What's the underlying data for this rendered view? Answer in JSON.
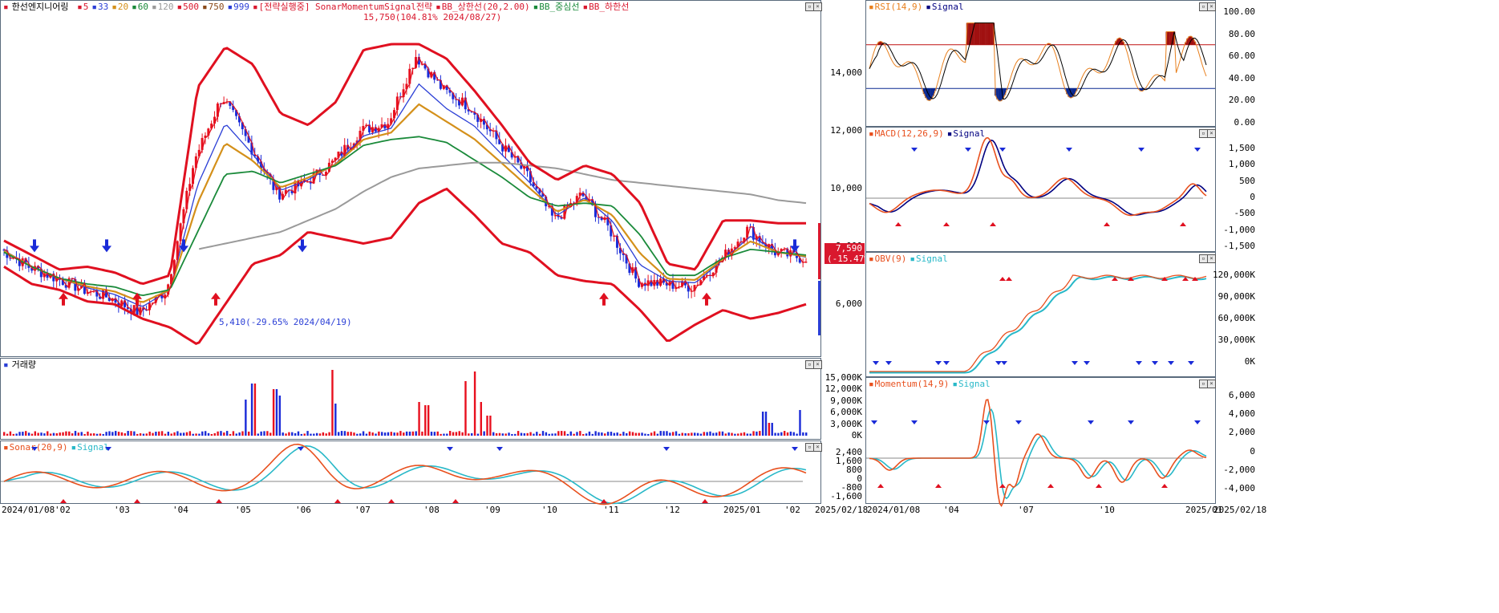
{
  "main_legend": {
    "title": "한선엔지니어링",
    "items": [
      {
        "text": "5",
        "color": "#d9182e"
      },
      {
        "text": "33",
        "color": "#2b3fd6"
      },
      {
        "text": "20",
        "color": "#d4901a"
      },
      {
        "text": "60",
        "color": "#1a8a3a"
      },
      {
        "text": "120",
        "color": "#9a9a9a"
      },
      {
        "text": "500",
        "color": "#d9182e"
      },
      {
        "text": "750",
        "color": "#8a4a1a"
      },
      {
        "text": "999",
        "color": "#2b3fd6"
      },
      {
        "text": "[전략실행중] SonarMomentumSignal전략",
        "color": "#d9182e"
      },
      {
        "text": "BB_상한선(20,2.00)",
        "color": "#d9182e"
      },
      {
        "text": "BB_중심선",
        "color": "#1a8a3a"
      },
      {
        "text": "BB_하한선",
        "color": "#d9182e"
      }
    ]
  },
  "volume_legend": {
    "title": "거래량"
  },
  "sonar_legend": {
    "items": [
      {
        "text": "Sonar(20,9)",
        "color": "#e8501e"
      },
      {
        "text": "Signal",
        "color": "#28b8c8"
      }
    ]
  },
  "rsi_legend": {
    "items": [
      {
        "text": "RSI(14,9)",
        "color": "#e8801e"
      },
      {
        "text": "Signal",
        "color": "#000080"
      }
    ]
  },
  "macd_legend": {
    "items": [
      {
        "text": "MACD(12,26,9)",
        "color": "#e8501e"
      },
      {
        "text": "Signal",
        "color": "#000080"
      }
    ]
  },
  "obv_legend": {
    "items": [
      {
        "text": "OBV(9)",
        "color": "#e8501e"
      },
      {
        "text": "Signal",
        "color": "#28b8c8"
      }
    ]
  },
  "mom_legend": {
    "items": [
      {
        "text": "Momentum(14,9)",
        "color": "#e8501e"
      },
      {
        "text": "Signal",
        "color": "#28b8c8"
      }
    ]
  },
  "annotations": {
    "high": "15,750(104.81% 2024/08/27)",
    "low": "5,410(-29.65% 2024/04/19)",
    "last_price": "7,590",
    "last_change": "(-15.47%)"
  },
  "chart_data": [
    {
      "type": "line",
      "name": "price",
      "x": [
        "2024/01/08",
        "'02",
        "'03",
        "'04",
        "'05",
        "'06",
        "'07",
        "'08",
        "'09",
        "'10",
        "'11",
        "'12",
        "2025/01",
        "'02",
        "2025/02/18"
      ],
      "price_ticks": [
        "14,000",
        "12,000",
        "10,000",
        "8,000",
        "6,000"
      ],
      "ylim": [
        4200,
        16500
      ],
      "series": [
        {
          "name": "종가",
          "values": [
            7900,
            7300,
            6900,
            6500,
            6200,
            5700,
            6500,
            11000,
            13200,
            11500,
            9800,
            10200,
            10900,
            12000,
            12300,
            14600,
            13400,
            12800,
            11600,
            10500,
            8900,
            9800,
            8600,
            6800,
            6700,
            6600,
            7500,
            8600,
            7800,
            7590
          ]
        },
        {
          "name": "BB_상한선",
          "values": [
            8200,
            7700,
            7200,
            7300,
            7100,
            6700,
            7000,
            13500,
            14900,
            14300,
            12600,
            12200,
            13000,
            14800,
            15000,
            15000,
            14500,
            13400,
            12200,
            10900,
            10300,
            10800,
            10500,
            9500,
            7400,
            7200,
            8900,
            8900,
            8800,
            8800
          ]
        },
        {
          "name": "BB_중심선",
          "values": [
            7800,
            7300,
            6900,
            6700,
            6600,
            6300,
            6500,
            8500,
            10500,
            10600,
            10200,
            10500,
            10800,
            11500,
            11700,
            11800,
            11600,
            11000,
            10400,
            9700,
            9400,
            9500,
            9400,
            8400,
            7000,
            7000,
            7600,
            7900,
            7800,
            7700
          ]
        },
        {
          "name": "BB_하한선",
          "values": [
            7300,
            6700,
            6500,
            6100,
            6000,
            5500,
            5200,
            4600,
            6000,
            7400,
            7700,
            8500,
            8300,
            8100,
            8300,
            9500,
            10000,
            9100,
            8100,
            7800,
            7000,
            6800,
            6700,
            5800,
            4700,
            5300,
            5800,
            5500,
            5700,
            6000
          ]
        },
        {
          "name": "120",
          "values": [
            null,
            null,
            null,
            null,
            null,
            null,
            null,
            7900,
            8100,
            8300,
            8500,
            8900,
            9300,
            9900,
            10400,
            10700,
            10800,
            10900,
            10900,
            10800,
            10700,
            10500,
            10300,
            10200,
            10100,
            10000,
            9900,
            9800,
            9600,
            9500
          ]
        }
      ]
    },
    {
      "type": "bar",
      "name": "거래량",
      "ticks": [
        "15,000K",
        "12,000K",
        "9,000K",
        "6,000K",
        "3,000K",
        "0K"
      ],
      "ylim": [
        0,
        16000
      ]
    },
    {
      "type": "line",
      "name": "Sonar(20,9)",
      "ticks": [
        "2,400",
        "1,600",
        "800",
        "0",
        "-800",
        "-1,600"
      ],
      "ylim": [
        -1800,
        2800
      ]
    },
    {
      "type": "line",
      "name": "RSI(14,9)",
      "ticks": [
        "100.00",
        "80.00",
        "60.00",
        "40.00",
        "20.00",
        "0.00"
      ],
      "ylim": [
        0,
        100
      ],
      "x": [
        "2024/01/08",
        "'04",
        "'07",
        "'10",
        "2025/01",
        "2025/02/18"
      ]
    },
    {
      "type": "line",
      "name": "MACD(12,26,9)",
      "ticks": [
        "1,500",
        "1,000",
        "500",
        "0",
        "-500",
        "-1,000",
        "-1,500"
      ],
      "ylim": [
        -1700,
        1800
      ]
    },
    {
      "type": "line",
      "name": "OBV(9)",
      "ticks": [
        "120,000K",
        "90,000K",
        "60,000K",
        "30,000K",
        "0K"
      ],
      "ylim": [
        -15000,
        140000
      ]
    },
    {
      "type": "line",
      "name": "Momentum(14,9)",
      "ticks": [
        "6,000",
        "4,000",
        "2,000",
        "0",
        "-2,000",
        "-4,000"
      ],
      "ylim": [
        -4800,
        7200
      ]
    }
  ]
}
